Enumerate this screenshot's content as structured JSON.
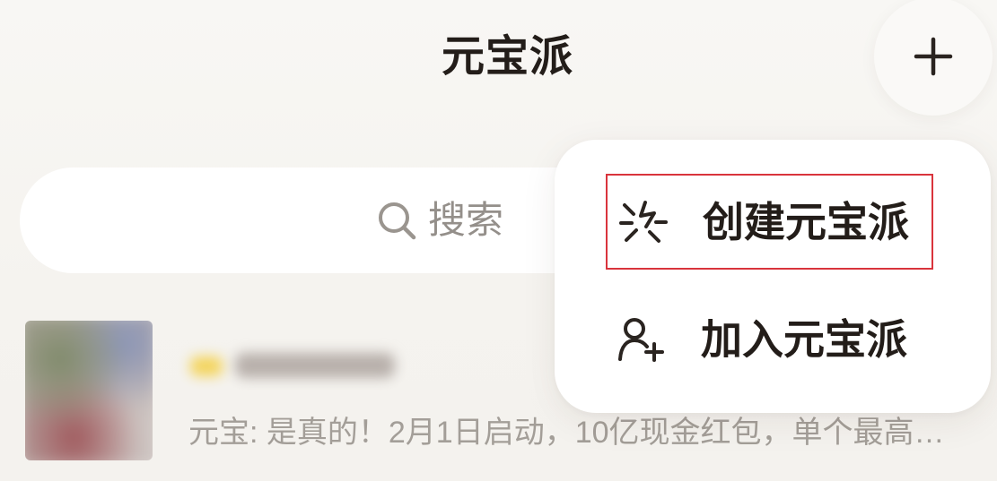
{
  "header": {
    "title": "元宝派",
    "add_button_icon": "plus-icon"
  },
  "search": {
    "icon": "search-icon",
    "placeholder": "搜索"
  },
  "conversations": {
    "items": [
      {
        "avatar_icon": "group-avatar",
        "preview": "元宝: 是真的！2月1日启动，10亿现金红包，单个最高…"
      }
    ]
  },
  "menu": {
    "items": [
      {
        "label": "创建元宝派",
        "icon": "sparkle-burst-icon",
        "highlighted": true
      },
      {
        "label": "加入元宝派",
        "icon": "add-person-icon",
        "highlighted": false
      }
    ]
  },
  "colors": {
    "background": "#f6f4f1",
    "text_primary": "#231d19",
    "text_secondary": "#a39e98",
    "placeholder": "#948f8a",
    "surface": "#ffffff",
    "highlight_border": "#d9343c"
  }
}
